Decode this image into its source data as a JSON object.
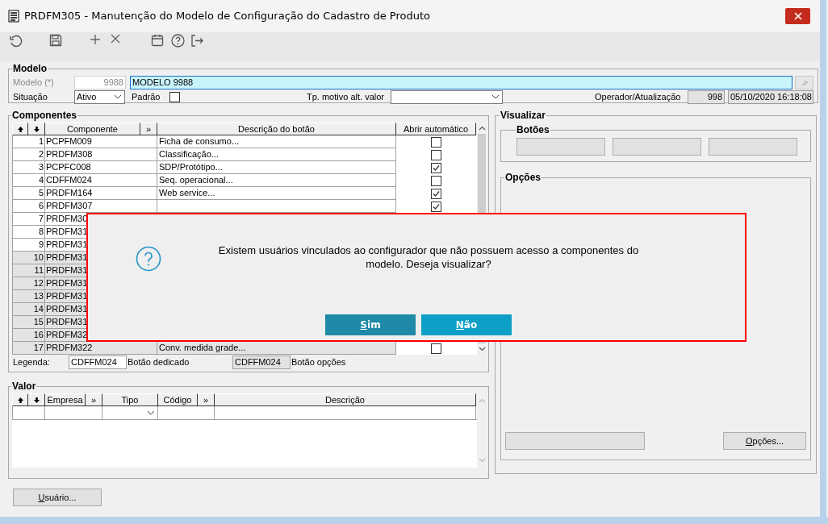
{
  "window": {
    "title": "PRDFM305 - Manutenção do Modelo de Configuração do Cadastro de Produto"
  },
  "modelo": {
    "title": "Modelo",
    "code_label": "Modelo (*)",
    "code": "9988",
    "name": "MODELO 9988",
    "situacao_label": "Situação",
    "situacao": "Ativo",
    "padrao_label": "Padrão",
    "padrao_checked": false,
    "motivo_label": "Tp. motivo alt. valor",
    "operador_label": "Operador/Atualização",
    "operador": "998",
    "updated": "05/10/2020 16:18:08"
  },
  "componentes": {
    "title": "Componentes",
    "columns": [
      "Componente",
      "»",
      "Descrição do botão",
      "Abrir automático"
    ],
    "rows": [
      {
        "n": "1",
        "code": "PCPFM009",
        "desc": "Ficha de consumo...",
        "checked": false,
        "kind": "dedicated"
      },
      {
        "n": "2",
        "code": "PRDFM308",
        "desc": "Classificação...",
        "checked": false,
        "kind": "dedicated"
      },
      {
        "n": "3",
        "code": "PCPFC008",
        "desc": "SDP/Protótipo...",
        "checked": true,
        "kind": "dedicated"
      },
      {
        "n": "4",
        "code": "CDFFM024",
        "desc": "Seq. operacional...",
        "checked": false,
        "kind": "dedicated"
      },
      {
        "n": "5",
        "code": "PRDFM164",
        "desc": "Web service...",
        "checked": true,
        "kind": "dedicated"
      },
      {
        "n": "6",
        "code": "PRDFM307",
        "checked": true,
        "kind": "dedicated"
      },
      {
        "n": "7",
        "code": "PRDFM30",
        "kind": "dedicated"
      },
      {
        "n": "8",
        "code": "PRDFM31",
        "kind": "dedicated"
      },
      {
        "n": "9",
        "code": "PRDFM31",
        "kind": "dedicated"
      },
      {
        "n": "10",
        "code": "PRDFM31",
        "kind": "options"
      },
      {
        "n": "11",
        "code": "PRDFM31",
        "kind": "options"
      },
      {
        "n": "12",
        "code": "PRDFM31",
        "kind": "options"
      },
      {
        "n": "13",
        "code": "PRDFM31",
        "kind": "options"
      },
      {
        "n": "14",
        "code": "PRDFM31",
        "kind": "options"
      },
      {
        "n": "15",
        "code": "PRDFM31",
        "kind": "options"
      },
      {
        "n": "16",
        "code": "PRDFM32",
        "kind": "options"
      },
      {
        "n": "17",
        "code": "PRDFM322",
        "desc": "Conv. medida grade...",
        "checked": false,
        "kind": "options"
      }
    ],
    "legend_label": "Legenda:",
    "legend": [
      {
        "code": "CDFFM024",
        "text": "Botão dedicado",
        "kind": "dedicated"
      },
      {
        "code": "CDFFM024",
        "text": "Botão opções",
        "kind": "options"
      }
    ]
  },
  "valor": {
    "title": "Valor",
    "columns": [
      "Empresa",
      "»",
      "Tipo",
      "Código",
      "»",
      "Descrição"
    ]
  },
  "usuario_button": {
    "label": "Usuário..."
  },
  "visualizar": {
    "title": "Visualizar",
    "botoes_title": "Botões",
    "opcoes_title": "Opções",
    "opcoes_button": {
      "label": "Opções..."
    }
  },
  "dialog": {
    "message": "Existem usuários vinculados ao configurador que não possuem acesso a componentes do modelo. Deseja visualizar?",
    "buttons": [
      {
        "label": "Sim",
        "selected": true
      },
      {
        "label": "Não",
        "selected": false
      }
    ]
  }
}
